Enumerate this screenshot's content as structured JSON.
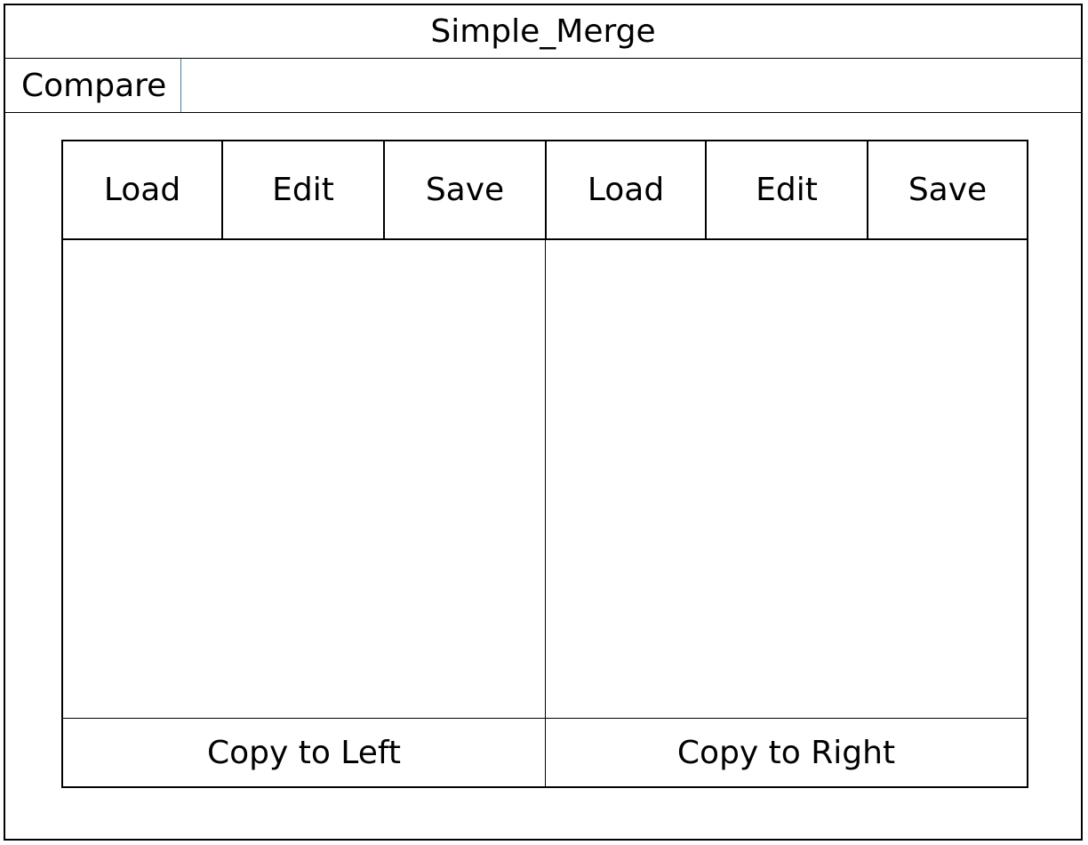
{
  "window": {
    "title": "Simple_Merge"
  },
  "menubar": {
    "items": [
      {
        "label": "Compare"
      }
    ]
  },
  "toolbar": {
    "left": {
      "load_label": "Load",
      "edit_label": "Edit",
      "save_label": "Save"
    },
    "right": {
      "load_label": "Load",
      "edit_label": "Edit",
      "save_label": "Save"
    }
  },
  "actions": {
    "copy_to_left_label": "Copy to Left",
    "copy_to_right_label": "Copy to Right"
  }
}
